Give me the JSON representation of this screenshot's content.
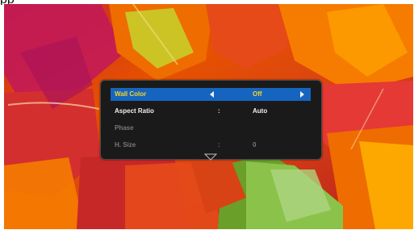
{
  "menu": {
    "rows": [
      {
        "label": "Wall Color",
        "value": "Off"
      },
      {
        "label": "Aspect Ratio",
        "separator": ":",
        "value": "Auto"
      },
      {
        "label": "Phase"
      },
      {
        "label": "H. Size",
        "separator": ":",
        "value": "0"
      }
    ]
  },
  "colors": {
    "selected_row": "#1565c0",
    "selected_label": "#ffd21f",
    "panel": "#1a1a1a",
    "disabled_text": "#7a7a7a"
  },
  "icons": [
    "left-arrow-icon",
    "right-arrow-icon",
    "down-scroll-arrow-icon"
  ]
}
